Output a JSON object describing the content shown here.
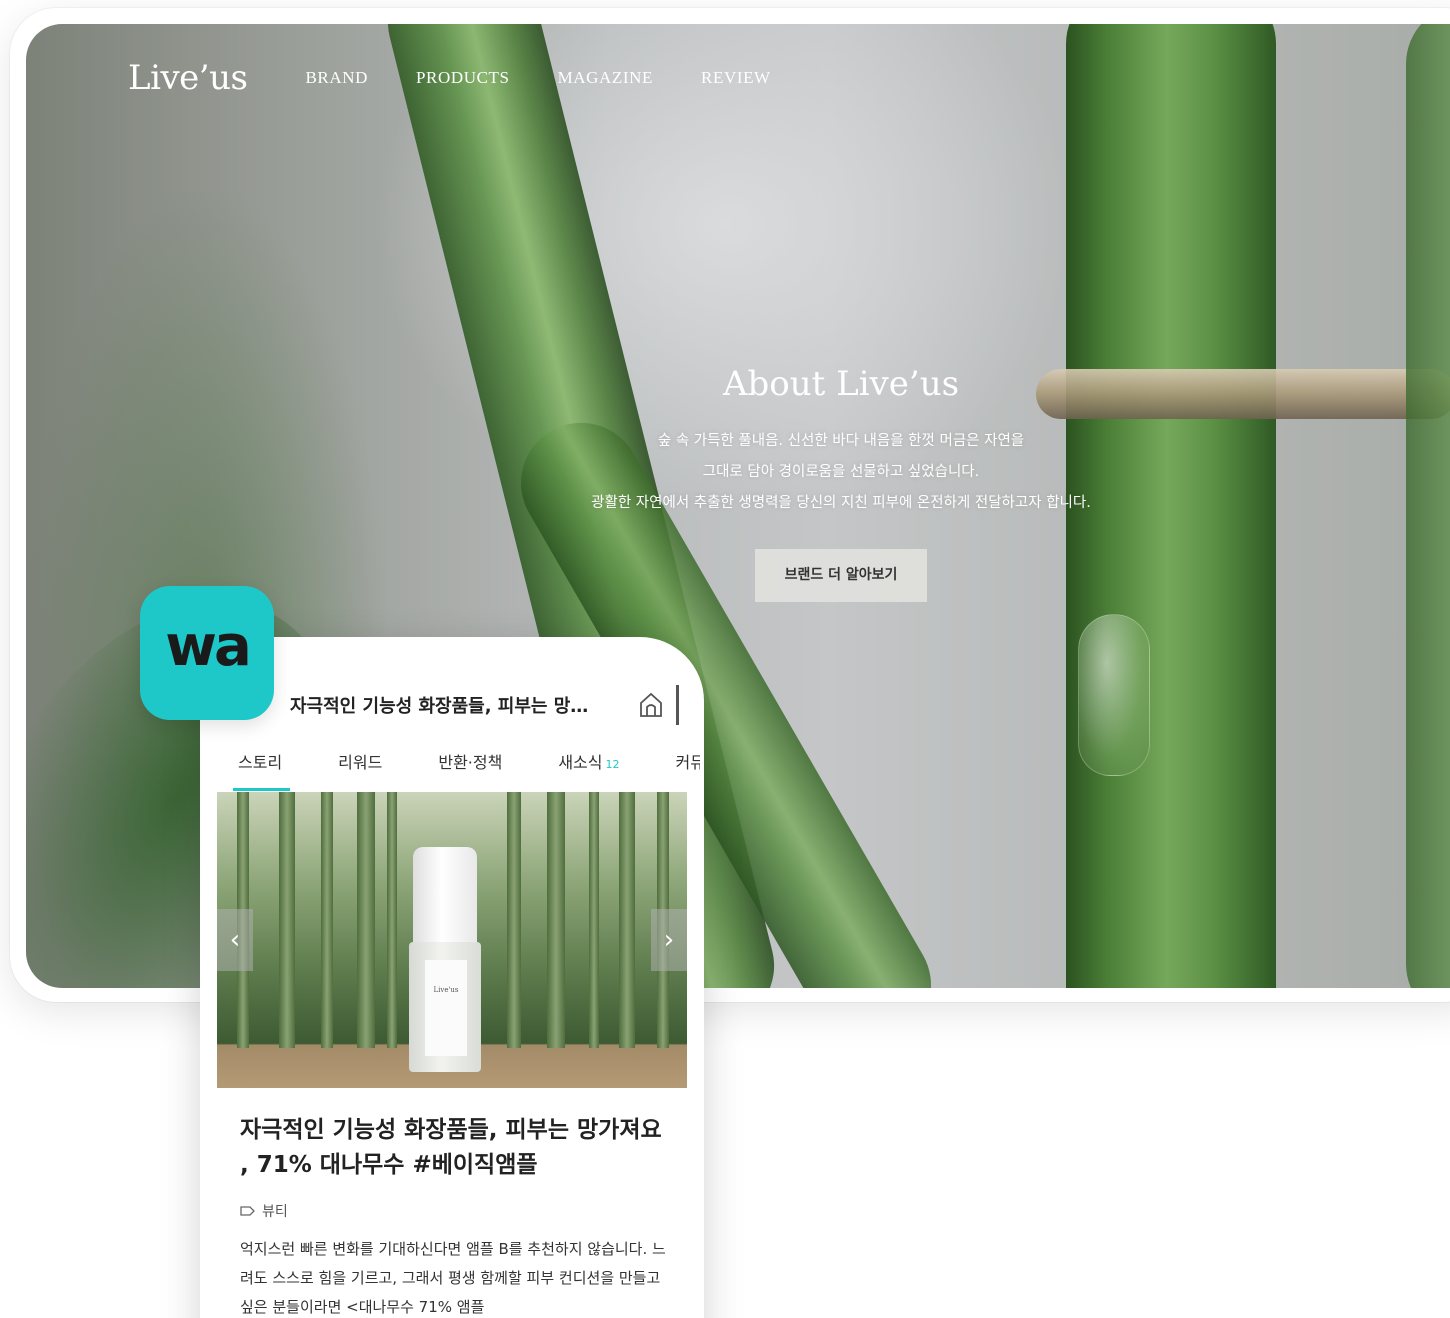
{
  "site": {
    "logo": "Live’us",
    "nav": [
      "BRAND",
      "PRODUCTS",
      "MAGAZINE",
      "REVIEW"
    ]
  },
  "hero": {
    "title": "About Live’us",
    "lines": [
      "숲 속 가득한 풀내음. 신선한 바다 내음을 한껏 머금은 자연을",
      "그대로 담아 경이로움을 선물하고 싶었습니다.",
      "광활한 자연에서 추출한 생명력을 당신의 지친 피부에 온전하게 전달하고자 합니다."
    ],
    "button": "브랜드 더 알아보기"
  },
  "app": {
    "icon_text": "wa",
    "header_title": "자극적인 기능성 화장품들, 피부는 망…",
    "home_icon": "home-icon",
    "tabs": [
      {
        "label": "스토리",
        "count": ""
      },
      {
        "label": "리워드",
        "count": ""
      },
      {
        "label": "반환·정책",
        "count": ""
      },
      {
        "label": "새소식",
        "count": "12"
      },
      {
        "label": "커뮤",
        "count": ""
      }
    ],
    "bottle_label": "Live'us",
    "article_title": "자극적인 기능성 화장품들, 피부는 망가져요 , 71% 대나무수 #베이직앰플",
    "category": "뷰티",
    "body": "억지스런 빠른 변화를 기대하신다면 앰플 B를 추천하지 않습니다. 느려도 스스로 힘을 기르고, 그래서 평생 함께할 피부 컨디션을 만들고 싶은 분들이라면 <대나무수 71% 앰플"
  },
  "colors": {
    "accent": "#1ec8c8"
  }
}
